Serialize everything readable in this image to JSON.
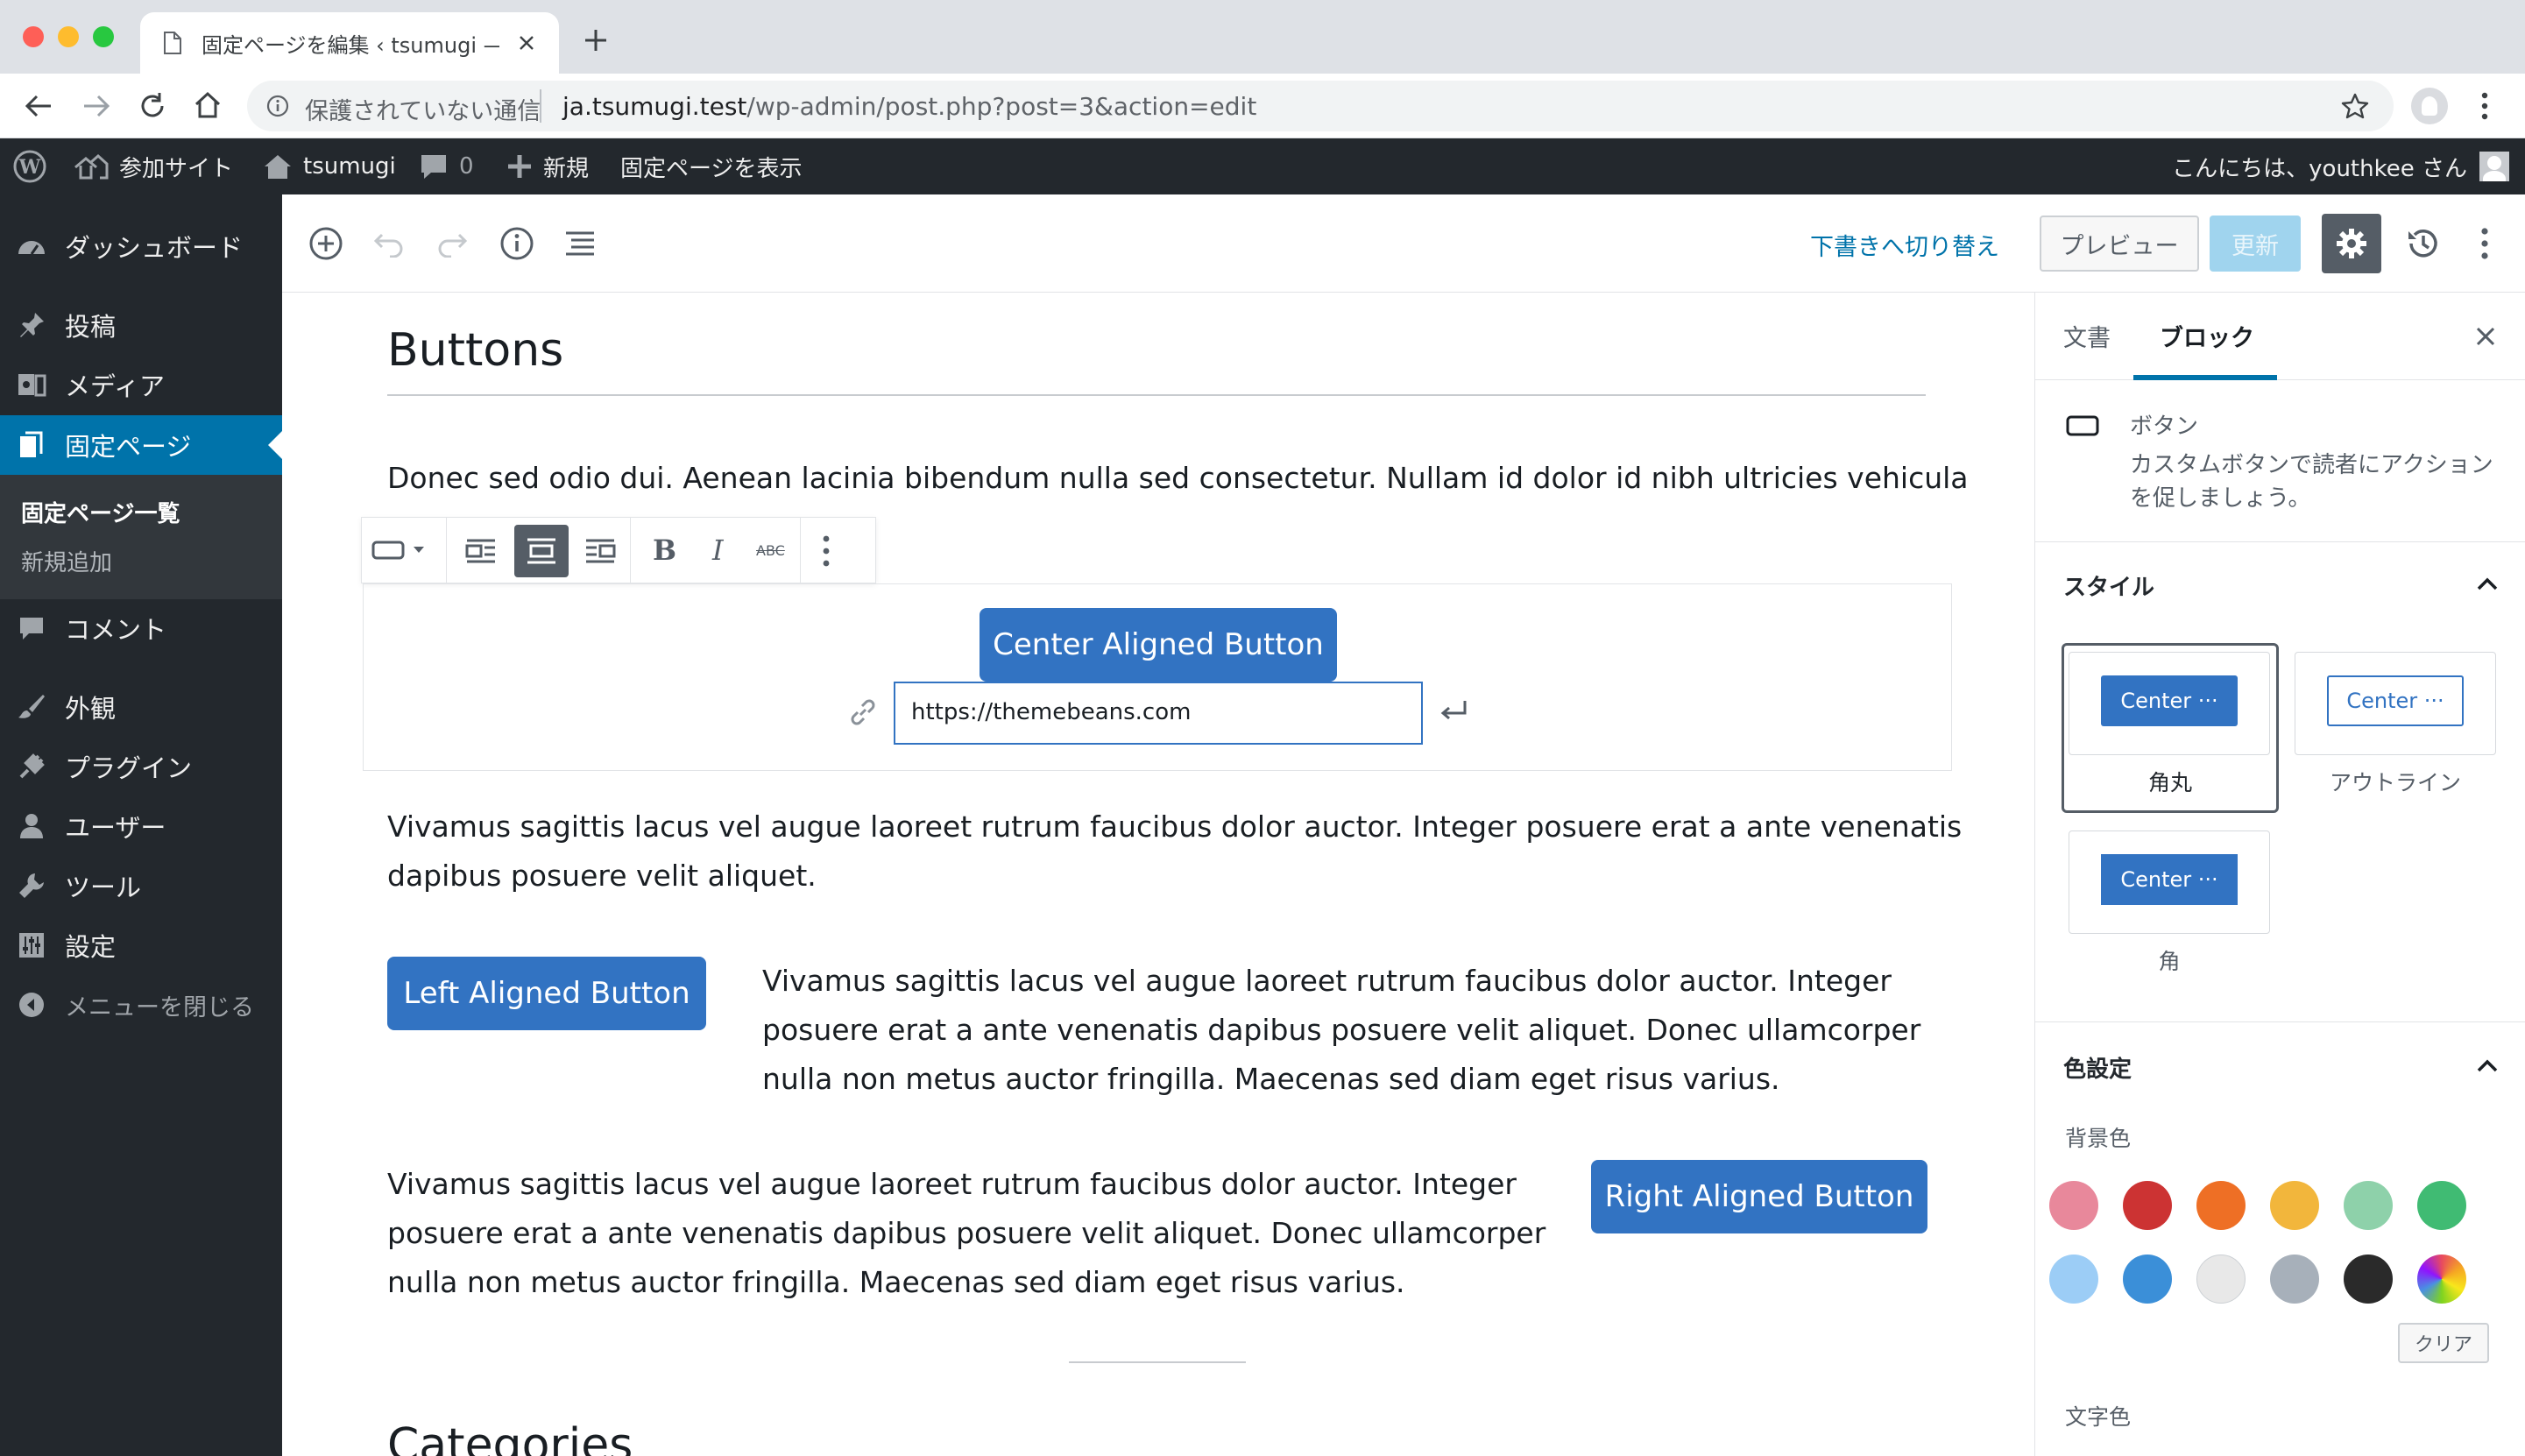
{
  "browser": {
    "tab_title": "固定ページを編集 ‹ tsumugi — W",
    "security_label": "保護されていない通信",
    "url_domain": "ja.tsumugi.test",
    "url_path": "/wp-admin/post.php?post=3&action=edit"
  },
  "adminbar": {
    "sites": "参加サイト",
    "site_name": "tsumugi",
    "comments_count": "0",
    "new": "新規",
    "view_page": "固定ページを表示",
    "greeting": "こんにちは、youthkee さん"
  },
  "sidebar": {
    "dashboard": "ダッシュボード",
    "posts": "投稿",
    "media": "メディア",
    "pages": "固定ページ",
    "pages_all": "固定ページ一覧",
    "pages_add": "新規追加",
    "comments": "コメント",
    "appearance": "外観",
    "plugins": "プラグイン",
    "users": "ユーザー",
    "tools": "ツール",
    "settings": "設定",
    "collapse": "メニューを閉じる"
  },
  "header": {
    "switch_draft": "下書きへ切り替え",
    "preview": "プレビュー",
    "update": "更新"
  },
  "content": {
    "title": "Buttons",
    "para1": "Donec sed odio dui. Aenean lacinia bibendum nulla sed consectetur. Nullam id dolor id nibh ultricies vehicula",
    "center_button": "Center Aligned Button",
    "url_value": "https://themebeans.com",
    "para2_line1": "Vivamus sagittis lacus vel augue laoreet rutrum faucibus dolor auctor. Integer posuere erat a ante venenatis",
    "para2_line2": "dapibus posuere velit aliquet.",
    "left_button": "Left Aligned Button",
    "para3_line1": "Vivamus sagittis lacus vel augue laoreet rutrum faucibus dolor auctor. Integer",
    "para3_line2": "posuere erat a ante venenatis dapibus posuere velit aliquet. Donec ullamcorper",
    "para3_line3": "nulla non metus auctor fringilla. Maecenas sed diam eget risus varius.",
    "para4_line1": "Vivamus sagittis lacus vel augue laoreet rutrum faucibus dolor auctor. Integer",
    "para4_line2": "posuere erat a ante venenatis dapibus posuere velit aliquet. Donec ullamcorper",
    "para4_line3": "nulla non metus auctor fringilla. Maecenas sed diam eget risus varius.",
    "right_button": "Right Aligned Button",
    "next_heading": "Categories"
  },
  "panel": {
    "tab_document": "文書",
    "tab_block": "ブロック",
    "block_name": "ボタン",
    "block_desc_line1": "カスタムボタンで読者にアクション",
    "block_desc_line2": "を促しましょう。",
    "styles_title": "スタイル",
    "style_preview": "Center ···",
    "style_rounded": "角丸",
    "style_outline": "アウトライン",
    "style_square": "角",
    "color_title": "色設定",
    "bg_color_label": "背景色",
    "clear": "クリア",
    "text_color_label": "文字色"
  },
  "colors": {
    "accent": "#0073aa",
    "button_blue": "#3273c2",
    "palette": [
      "#e8889b",
      "#cc3333",
      "#ee6f25",
      "#f2b63c",
      "#8ed1aa",
      "#40bb73",
      "#9ccdf6",
      "#3b8fd8",
      "#e8e8e8",
      "#a7b0ba",
      "#2a2a2a",
      "gradient"
    ]
  }
}
